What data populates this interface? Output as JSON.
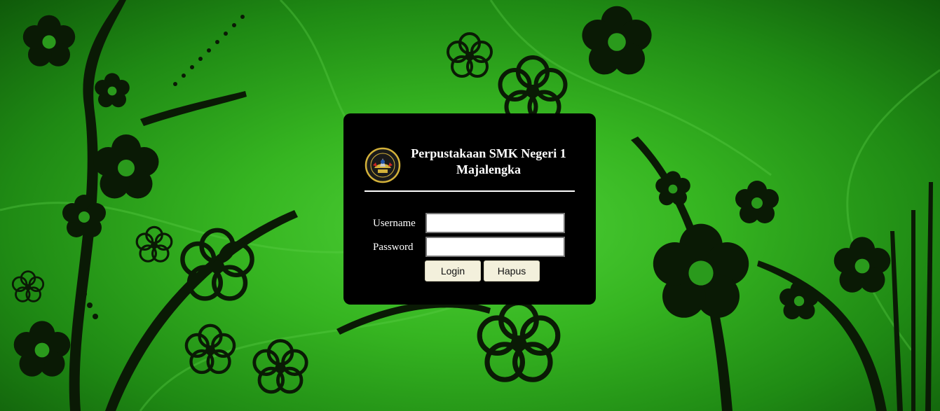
{
  "header": {
    "title": "Perpustakaan SMK Negeri 1 Majalengka",
    "logo_icon": "school-emblem-icon"
  },
  "form": {
    "username_label": "Username",
    "password_label": "Password",
    "username_value": "",
    "password_value": "",
    "login_label": "Login",
    "reset_label": "Hapus"
  },
  "colors": {
    "background_green": "#36b521",
    "panel": "#000000",
    "button": "#f3f0dc",
    "text": "#ffffff"
  }
}
